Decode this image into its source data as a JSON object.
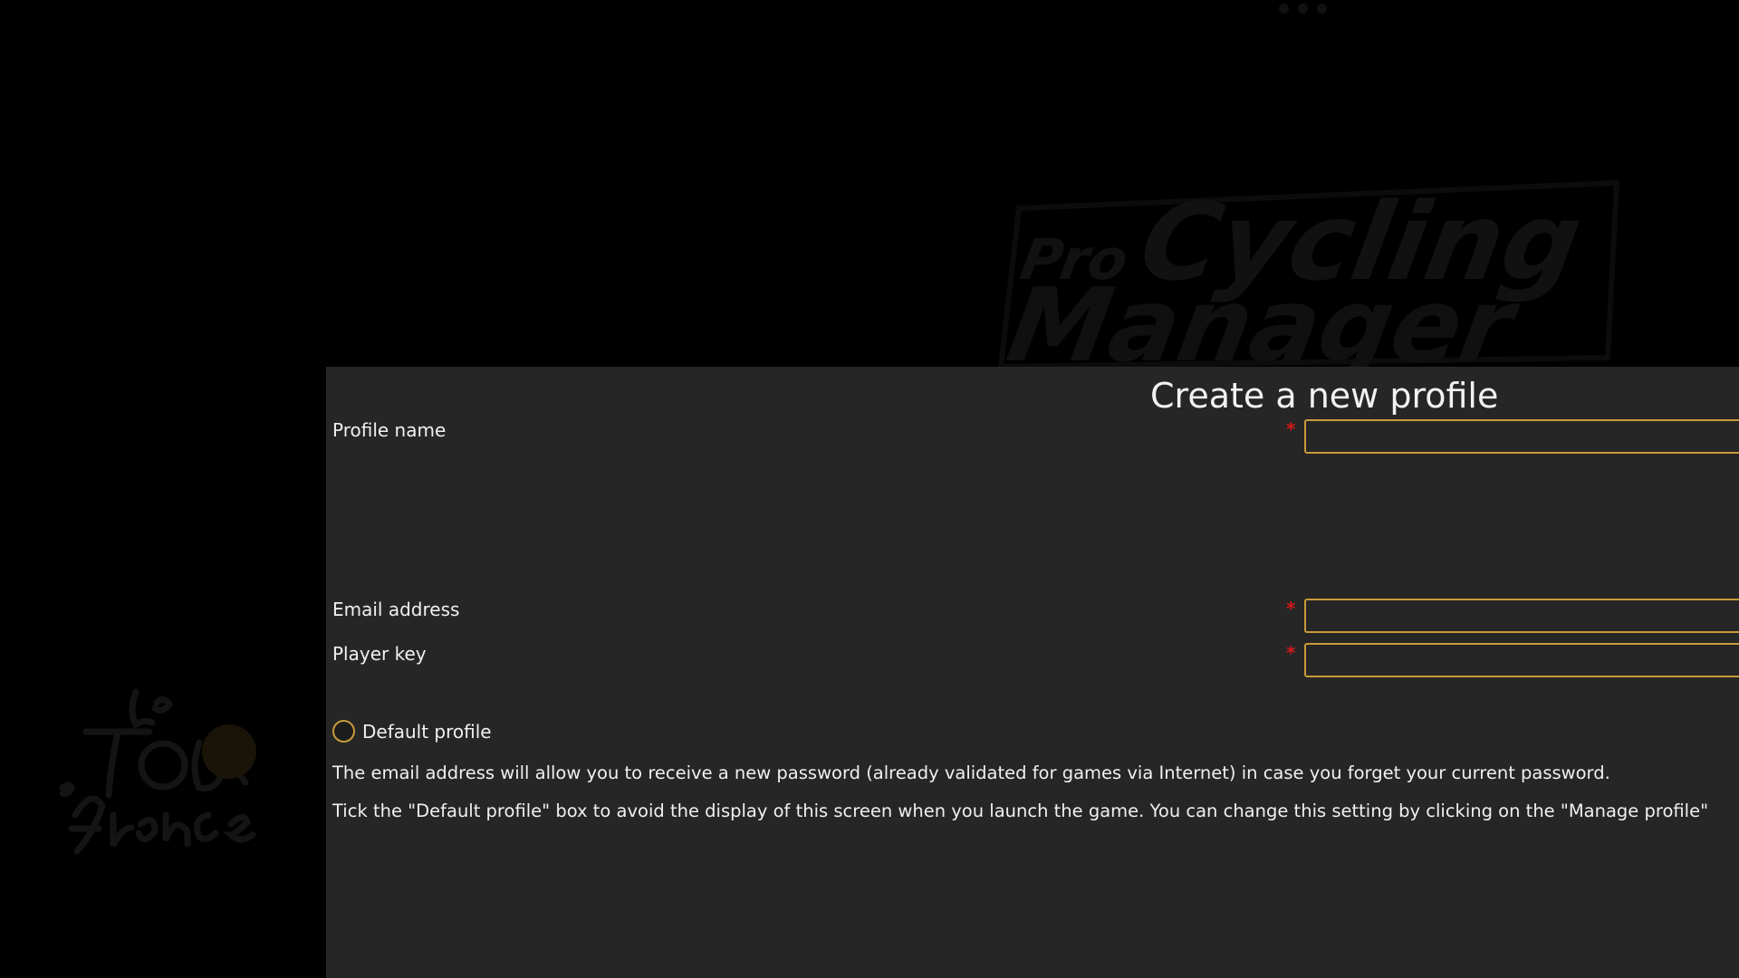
{
  "form": {
    "title": "Create a new profile",
    "required_marker": "*",
    "fields": {
      "profile_name": {
        "label": "Profile name",
        "value": ""
      },
      "email": {
        "label": "Email address",
        "value": ""
      },
      "player_key": {
        "label": "Player key",
        "value": ""
      }
    },
    "default_profile": {
      "label": "Default profile",
      "checked": false
    },
    "help": {
      "email_note": "The email address will allow you to receive a new password (already validated for games via Internet) in case you forget your current password.",
      "default_note": "Tick the \"Default profile\" box to avoid the display of this screen when you launch the game. You can change this setting by clicking on the \"Manage profile\""
    }
  },
  "branding": {
    "game_logo": "Pro Cycling Manager",
    "tour_logo": "Le Tour de France"
  },
  "colors": {
    "accent": "#c89a3a",
    "required": "#d01818",
    "panel": "#262626",
    "background": "#000000"
  }
}
